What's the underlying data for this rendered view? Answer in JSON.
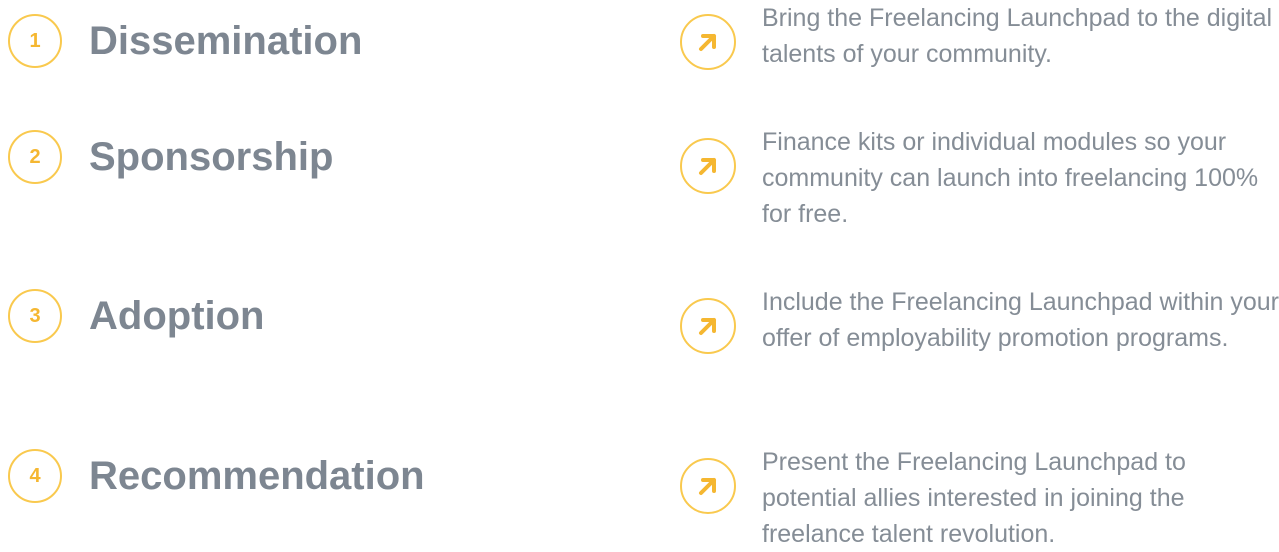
{
  "steps": [
    {
      "number": "1",
      "title": "Dissemination",
      "description": "Bring the Freelancing Launchpad to the digital talents of your community."
    },
    {
      "number": "2",
      "title": "Sponsorship",
      "description": "Finance kits or individual modules so your community can launch into freelancing 100% for free."
    },
    {
      "number": "3",
      "title": "Adoption",
      "description": "Include the Freelancing Launchpad within your offer of employability promotion programs."
    },
    {
      "number": "4",
      "title": "Recommendation",
      "description": "Present the Freelancing Launchpad to potential allies interested in joining the freelance talent revolution."
    }
  ],
  "icon": "arrow-up-right-icon",
  "colors": {
    "accent": "#f5b731",
    "circle_border": "#f9c94e",
    "title": "#7d8691",
    "text": "#858d96"
  }
}
